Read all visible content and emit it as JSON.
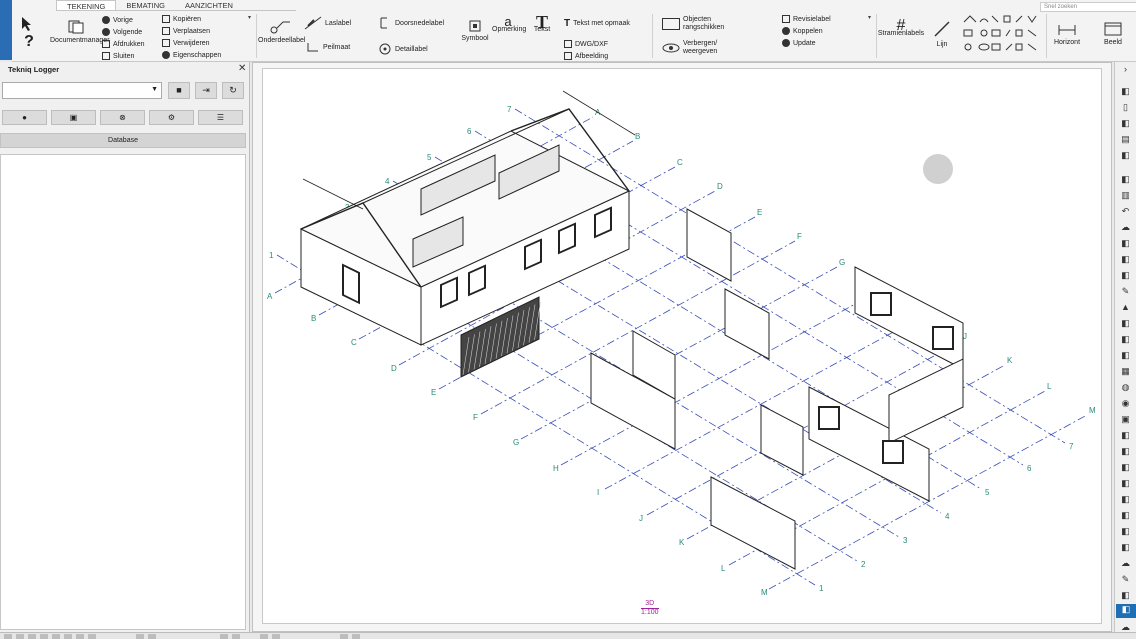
{
  "ribbon": {
    "tabs": [
      "TEKENING",
      "BEMATING",
      "AANZICHTEN"
    ],
    "search_placeholder": "Snel zoeken",
    "document_manager": "Documentmanager",
    "nav": {
      "prev": "Vorige",
      "next": "Volgende",
      "print": "Afdrukken",
      "close": "Sluiten"
    },
    "edit": {
      "copy": "Kopiëren",
      "move": "Verplaatsen",
      "delete": "Verwijderen",
      "props": "Eigenschappen"
    },
    "onderdeel_label": "Onderdeellabel",
    "laslabel": "Laslabel",
    "peilmaat": "Peilmaat",
    "doorsnede_label": "Doorsnedelabel",
    "detail_label": "Detaillabel",
    "symbool": "Symbool",
    "opmerking": "Opmerking",
    "tekst": "Tekst",
    "tekst_opmaak": "Tekst met opmaak",
    "dwg_dxf": "DWG/DXF",
    "afbeelding": "Afbeelding",
    "objecten": "Objecten rangschikken",
    "verbergen": "Verbergen/ weergeven",
    "revisie": "Revisielabel",
    "koppelen": "Koppelen",
    "update": "Update",
    "stramien": "Stramienlabels",
    "lijn": "Lijn",
    "horizont": "Horizont",
    "beeld": "Beeld"
  },
  "panel": {
    "title": "Tekniq Logger",
    "combo_value": "",
    "database_label": "Database"
  },
  "canvas": {
    "view_name": "3D",
    "scale": "1:100",
    "grid_letters": [
      "A",
      "B",
      "C",
      "D",
      "E",
      "F",
      "G",
      "H",
      "I",
      "J",
      "K",
      "L",
      "M"
    ],
    "grid_numbers": [
      "1",
      "2",
      "3",
      "4",
      "5",
      "6",
      "7"
    ]
  },
  "colors": {
    "grid_line": "#3a4fb8",
    "grid_label": "#2a8a7a",
    "view_label": "#a020a0",
    "accent": "#1e6fb4"
  }
}
